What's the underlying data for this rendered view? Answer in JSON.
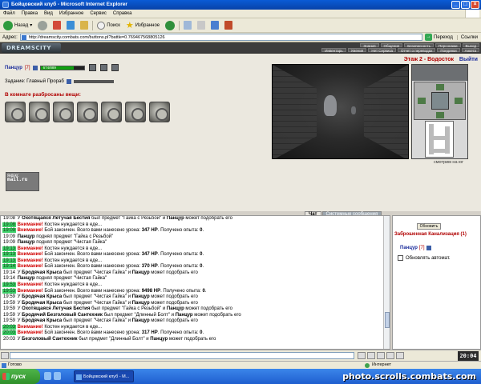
{
  "window": {
    "title": "Бойцовский клуб - Microsoft Internet Explorer"
  },
  "menu": [
    "Файл",
    "Правка",
    "Вид",
    "Избранное",
    "Сервис",
    "Справка"
  ],
  "toolbar": {
    "back": "Назад",
    "search": "Поиск",
    "favorites": "Избранное"
  },
  "address": {
    "label": "Адрес:",
    "url": "http://dreamscity.combats.com/buttons.pl?battle=0.769467568805126",
    "go": "Переход",
    "links": "Ссылки"
  },
  "game_nav": {
    "logo": "DREAMSCITY",
    "top": [
      "Знания",
      "Общение",
      "Безопасность",
      "Персонажи",
      "Выход"
    ],
    "bottom": [
      "Инвентарь",
      "Умения",
      "Нет Сервиза",
      "Отчет о переводах",
      "Поединки",
      "Анкета"
    ]
  },
  "player": {
    "name": "Панцур",
    "level": "[7]",
    "hp": "674/889",
    "hp_fraction": 0.76
  },
  "task": {
    "label": "Задание: Главный Прораб"
  },
  "items_title": "В комнате разбросаны вещи:",
  "items_count": 7,
  "counter": {
    "line1": "ЯНДЕКС",
    "line2": "mail.ru"
  },
  "location": {
    "floor": "Этаж 2 - Водосток",
    "exit": "Выйти"
  },
  "view_caption": "смотрим на юг",
  "chat": {
    "tabs": [
      "Чат",
      "Системные сообщения"
    ],
    "lines": [
      [
        {
          "t": "19:08",
          "c": "time"
        },
        {
          "t": " У "
        },
        {
          "t": "Охотящаяся Летучая Бестия",
          "c": "b"
        },
        {
          "t": " был предмет \"Гайка с Резьбой\" и "
        },
        {
          "t": "Панцур",
          "c": "b"
        },
        {
          "t": " может подобрать его"
        }
      ],
      [
        {
          "t": "19:08",
          "c": "time warn"
        },
        {
          "t": " Внимание!",
          "c": "warn"
        },
        {
          "t": " Костен нуждается в еде..."
        }
      ],
      [
        {
          "t": "19:09",
          "c": "time warn"
        },
        {
          "t": " Внимание!",
          "c": "warn"
        },
        {
          "t": " Бой закончен. Всего вами нанесено урона: "
        },
        {
          "t": "347 HP",
          "c": "b"
        },
        {
          "t": ". Получено опыта: "
        },
        {
          "t": "0",
          "c": "b"
        },
        {
          "t": "."
        }
      ],
      [
        {
          "t": "19:09",
          "c": "time"
        },
        {
          "t": " "
        },
        {
          "t": "Панцур",
          "c": "b"
        },
        {
          "t": " поднял предмет \"Гайка с Резьбой\""
        }
      ],
      [
        {
          "t": "19:09",
          "c": "time"
        },
        {
          "t": " "
        },
        {
          "t": "Панцур",
          "c": "b"
        },
        {
          "t": " поднял предмет \"Чистая Гайка\""
        }
      ],
      [
        {
          "t": "19:13",
          "c": "time warn"
        },
        {
          "t": " Внимание!",
          "c": "warn"
        },
        {
          "t": " Костен нуждается в еде..."
        }
      ],
      [
        {
          "t": "19:13",
          "c": "time warn"
        },
        {
          "t": " Внимание!",
          "c": "warn"
        },
        {
          "t": " Бой закончен. Всего вами нанесено урона: "
        },
        {
          "t": "347 HP",
          "c": "b"
        },
        {
          "t": ". Получено опыта: "
        },
        {
          "t": "0",
          "c": "b"
        },
        {
          "t": "."
        }
      ],
      [
        {
          "t": "19:13",
          "c": "time warn"
        },
        {
          "t": " Внимание!",
          "c": "warn"
        },
        {
          "t": " Костен нуждается в еде..."
        }
      ],
      [
        {
          "t": "19:14",
          "c": "time warn"
        },
        {
          "t": " Внимание!",
          "c": "warn"
        },
        {
          "t": " Бой закончен. Всего вами нанесено урона: "
        },
        {
          "t": "370 HP",
          "c": "b"
        },
        {
          "t": ". Получено опыта: "
        },
        {
          "t": "0",
          "c": "b"
        },
        {
          "t": "."
        }
      ],
      [
        {
          "t": "19:14",
          "c": "time"
        },
        {
          "t": " У "
        },
        {
          "t": "Бродячая Крыса",
          "c": "b"
        },
        {
          "t": " был предмет \"Чистая Гайка\" и "
        },
        {
          "t": "Панцур",
          "c": "b"
        },
        {
          "t": " может подобрать его"
        }
      ],
      [
        {
          "t": "19:14",
          "c": "time"
        },
        {
          "t": " "
        },
        {
          "t": "Панцур",
          "c": "b"
        },
        {
          "t": " поднял предмет \"Чистая Гайка\""
        }
      ],
      [
        {
          "t": "19:53",
          "c": "time warn"
        },
        {
          "t": " Внимание!",
          "c": "warn"
        },
        {
          "t": " Костен нуждается в еде..."
        }
      ],
      [
        {
          "t": "19:53",
          "c": "time warn"
        },
        {
          "t": " Внимание!",
          "c": "warn"
        },
        {
          "t": " Бой закончен. Всего вами нанесено урона: "
        },
        {
          "t": "9498 HP",
          "c": "b"
        },
        {
          "t": ". Получено опыта: "
        },
        {
          "t": "0",
          "c": "b"
        },
        {
          "t": "."
        }
      ],
      [
        {
          "t": "19:59",
          "c": "time"
        },
        {
          "t": " У "
        },
        {
          "t": "Бродячая Крыса",
          "c": "b"
        },
        {
          "t": " был предмет \"Чистая Гайка\" и "
        },
        {
          "t": "Панцур",
          "c": "b"
        },
        {
          "t": " может подобрать его"
        }
      ],
      [
        {
          "t": "19:59",
          "c": "time"
        },
        {
          "t": " У "
        },
        {
          "t": "Бродячая Крыса",
          "c": "b"
        },
        {
          "t": " был предмет \"Чистая Гайка\" и "
        },
        {
          "t": "Панцур",
          "c": "b"
        },
        {
          "t": " может подобрать его"
        }
      ],
      [
        {
          "t": "19:59",
          "c": "time"
        },
        {
          "t": " У "
        },
        {
          "t": "Охотящаяся Летучая Бестия",
          "c": "b"
        },
        {
          "t": " был предмет \"Гайка с Резьбой\" и "
        },
        {
          "t": "Панцур",
          "c": "b"
        },
        {
          "t": " может подобрать его"
        }
      ],
      [
        {
          "t": "19:59",
          "c": "time"
        },
        {
          "t": " У "
        },
        {
          "t": "Бродячий Безголовый Сантехник",
          "c": "b"
        },
        {
          "t": " был предмет \"Длинный Болт\" и "
        },
        {
          "t": "Панцур",
          "c": "b"
        },
        {
          "t": " может подобрать его"
        }
      ],
      [
        {
          "t": "19:59",
          "c": "time"
        },
        {
          "t": " У "
        },
        {
          "t": "Бродячая Крыса",
          "c": "b"
        },
        {
          "t": " был предмет \"Чистая Гайка\" и "
        },
        {
          "t": "Панцур",
          "c": "b"
        },
        {
          "t": " может подобрать его"
        }
      ],
      [
        {
          "t": "20:03",
          "c": "time warn"
        },
        {
          "t": " Внимание!",
          "c": "warn"
        },
        {
          "t": " Костен нуждается в еде..."
        }
      ],
      [
        {
          "t": "20:03",
          "c": "time warn"
        },
        {
          "t": " Внимание!",
          "c": "warn"
        },
        {
          "t": " Бой закончен. Всего вами нанесено урона: "
        },
        {
          "t": "317 HP",
          "c": "b"
        },
        {
          "t": ". Получено опыта: "
        },
        {
          "t": "0",
          "c": "b"
        },
        {
          "t": "."
        }
      ],
      [
        {
          "t": "20:03",
          "c": "time"
        },
        {
          "t": " У "
        },
        {
          "t": "Безголовый Сантехник",
          "c": "b"
        },
        {
          "t": " был предмет \"Длинный Болт\" и "
        },
        {
          "t": "Панцур",
          "c": "b"
        },
        {
          "t": " может подобрать его"
        }
      ]
    ]
  },
  "side": {
    "refresh": "Обновить",
    "location": "Заброшенная Канализация (1)",
    "player": "Панцур",
    "level": "[7]",
    "auto": "Обновлять автомат."
  },
  "clock": "20:04",
  "status": {
    "done": "Готово",
    "zone": "Интернет"
  },
  "taskbar": {
    "start": "пуск",
    "item": "Бойцовский клуб - M..."
  },
  "watermark": "photo.scrolls.combats.com",
  "colors": {
    "accent_red": "#b00000",
    "name_blue": "#1a2b9a",
    "warn_bg": "#3ed06a",
    "hp_green": "#10a010"
  }
}
